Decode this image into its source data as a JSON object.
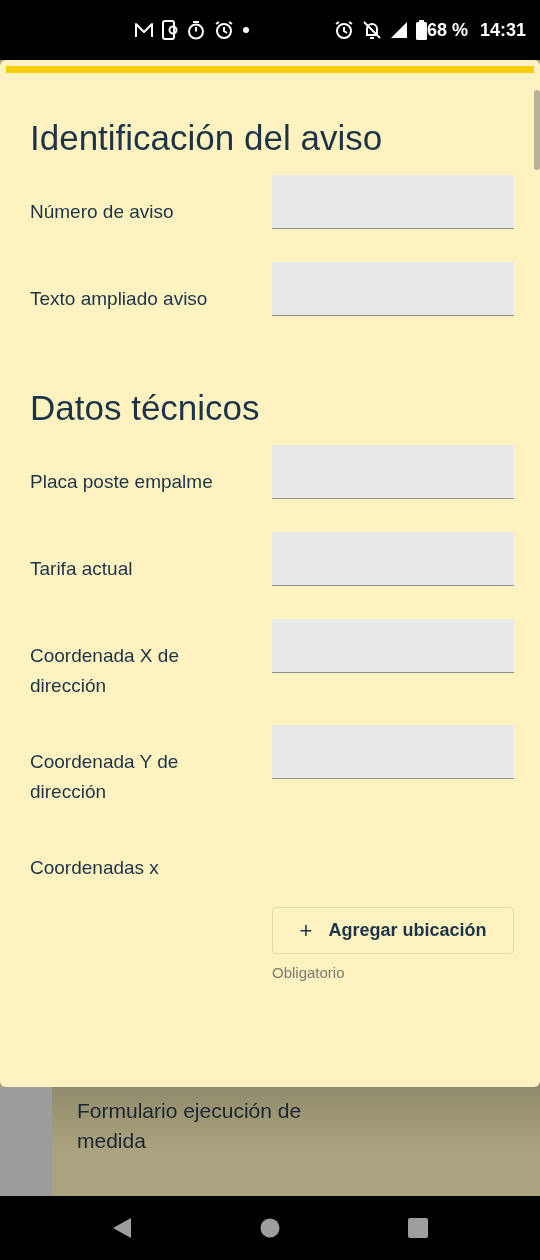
{
  "status_bar": {
    "battery": "68 %",
    "time": "14:31"
  },
  "dialog": {
    "sections": [
      {
        "title": "Identificación del aviso",
        "fields": [
          {
            "kind": "input",
            "label": "Número de aviso"
          },
          {
            "kind": "input",
            "label": "Texto ampliado aviso"
          }
        ]
      },
      {
        "title": "Datos técnicos",
        "fields": [
          {
            "kind": "input",
            "label": "Placa poste empalme"
          },
          {
            "kind": "input",
            "label": "Tarifa actual"
          },
          {
            "kind": "input",
            "label": "Coordenada X de dirección"
          },
          {
            "kind": "input",
            "label": "Coordenada Y de dirección"
          },
          {
            "kind": "location",
            "label": "Coordenadas x",
            "button_icon": "+",
            "button": "Agregar ubicación",
            "hint": "Obligatorio"
          }
        ]
      }
    ]
  },
  "background_card": {
    "title": "Formulario ejecución de medida"
  }
}
